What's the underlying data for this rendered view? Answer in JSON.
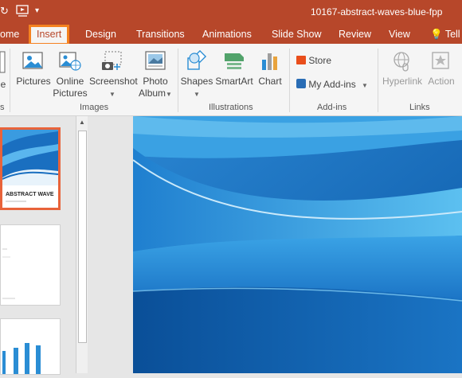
{
  "window": {
    "title": "10167-abstract-waves-blue-fpp"
  },
  "tabs": [
    {
      "label": "ome"
    },
    {
      "label": "Insert"
    },
    {
      "label": "Design"
    },
    {
      "label": "Transitions"
    },
    {
      "label": "Animations"
    },
    {
      "label": "Slide Show"
    },
    {
      "label": "Review"
    },
    {
      "label": "View"
    },
    {
      "label": "Tell"
    }
  ],
  "ribbon": {
    "images": {
      "label": "Images",
      "pictures": "Pictures",
      "online_line1": "Online",
      "online_line2": "Pictures",
      "screenshot": "Screenshot",
      "album_line1": "Photo",
      "album_line2": "Album"
    },
    "illustrations": {
      "label": "Illustrations",
      "shapes": "Shapes",
      "smartart": "SmartArt",
      "chart": "Chart"
    },
    "addins": {
      "label": "Add-ins",
      "store": "Store",
      "my_addins": "My Add-ins"
    },
    "links": {
      "label": "Links",
      "hyperlink": "Hyperlink",
      "action": "Action"
    },
    "left_fragment_label": "e",
    "left_fragment_group": "s"
  },
  "slides": {
    "slide1_title": "ABSTRACT WAVE"
  },
  "colors": {
    "brand": "#b7472a",
    "highlight": "#f58220",
    "slide_blue": "#1a6fc0"
  }
}
